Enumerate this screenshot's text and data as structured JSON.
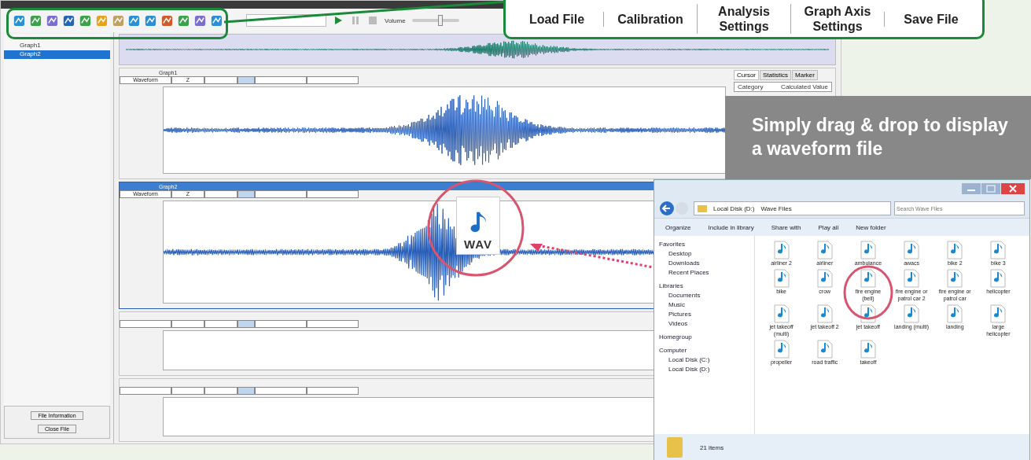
{
  "toolbar": {
    "volume_label": "Volume",
    "volume": {
      "level": 0.6
    }
  },
  "callout": {
    "labels": [
      "Load File",
      "Calibration",
      "Analysis Settings",
      "Graph Axis Settings",
      "Save File"
    ]
  },
  "banner": "Simply drag & drop to display a waveform file",
  "sidebar": {
    "items": [
      {
        "label": "Graph1",
        "selected": false
      },
      {
        "label": "Graph2",
        "selected": true
      }
    ],
    "buttons": [
      "File Information",
      "Close File"
    ]
  },
  "graphs": [
    {
      "kind": "waveform",
      "title": "Graph1",
      "mode": "Waveform",
      "channel": "Z",
      "selected": false
    },
    {
      "kind": "waveform",
      "title": "Graph2",
      "mode": "Waveform",
      "channel": "Z",
      "selected": true
    },
    {
      "kind": "empty",
      "selected": false
    },
    {
      "kind": "empty",
      "selected": false
    }
  ],
  "side_panel": {
    "tabs": [
      {
        "label": "Cursor",
        "selected": true
      },
      {
        "label": "Statistics",
        "selected": false
      },
      {
        "label": "Marker",
        "selected": false
      }
    ],
    "columns": [
      "Category",
      "Calculated Value"
    ]
  },
  "drag_file": {
    "label": "WAV"
  },
  "explorer": {
    "path": [
      "Local Disk (D:)",
      "Wave Files"
    ],
    "search": {
      "placeholder": "Search Wave Files"
    },
    "commands": [
      "Organize",
      "Include in library",
      "Share with",
      "Play all",
      "New folder"
    ],
    "nav": [
      {
        "label": "Favorites",
        "children": [
          "Desktop",
          "Downloads",
          "Recent Places"
        ]
      },
      {
        "label": "Libraries",
        "children": [
          "Documents",
          "Music",
          "Pictures",
          "Videos"
        ]
      },
      {
        "label": "Homegroup"
      },
      {
        "label": "Computer",
        "children": [
          "Local Disk (C:)",
          "Local Disk (D:)"
        ]
      }
    ],
    "files": [
      "airliner 2",
      "airliner",
      "ambulance",
      "awacs",
      "bike 2",
      "bike 3",
      "bike",
      "crow",
      "fire engine (bell)",
      "fire engine or patrol car 2",
      "fire engine or patrol car",
      "helicopter",
      "jet takeoff (multi)",
      "jet takeoff 2",
      "jet takeoff",
      "landing (multi)",
      "landing",
      "large helicopter",
      "propeller",
      "road traffic",
      "takeoff"
    ],
    "status": "21 items"
  }
}
